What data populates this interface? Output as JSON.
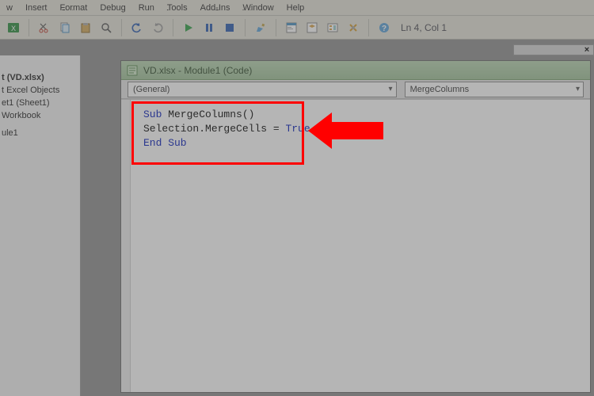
{
  "menu": {
    "items": [
      "w",
      "Insert",
      "Format",
      "Debug",
      "Run",
      "Tools",
      "Add-Ins",
      "Window",
      "Help"
    ]
  },
  "status": {
    "position": "Ln 4, Col 1"
  },
  "project": {
    "close_glyph": "×",
    "root": "t (VD.xlsx)",
    "folder": "t Excel Objects",
    "sheet": "et1 (Sheet1)",
    "workbook": "Workbook",
    "module": "ule1"
  },
  "code_window": {
    "title": "VD.xlsx - Module1 (Code)",
    "dropdown_left": "(General)",
    "dropdown_right": "MergeColumns",
    "code": {
      "line1_kw": "Sub",
      "line1_rest": " MergeColumns()",
      "line2_a": "Selection.MergeCells = ",
      "line2_kw": "True",
      "line3_kw": "End Sub"
    }
  }
}
